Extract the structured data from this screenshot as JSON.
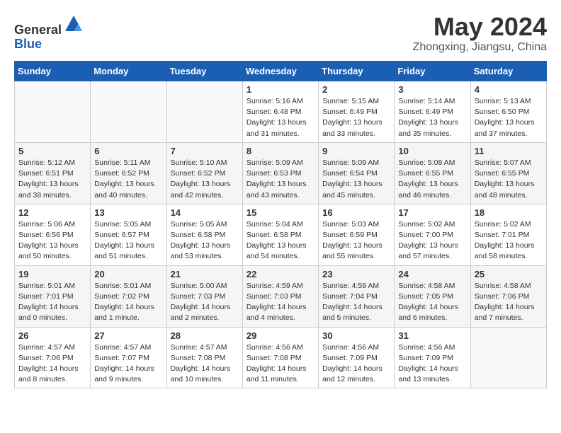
{
  "header": {
    "logo_line1": "General",
    "logo_line2": "Blue",
    "month_year": "May 2024",
    "location": "Zhongxing, Jiangsu, China"
  },
  "weekdays": [
    "Sunday",
    "Monday",
    "Tuesday",
    "Wednesday",
    "Thursday",
    "Friday",
    "Saturday"
  ],
  "weeks": [
    [
      {
        "day": "",
        "info": ""
      },
      {
        "day": "",
        "info": ""
      },
      {
        "day": "",
        "info": ""
      },
      {
        "day": "1",
        "info": "Sunrise: 5:16 AM\nSunset: 6:48 PM\nDaylight: 13 hours\nand 31 minutes."
      },
      {
        "day": "2",
        "info": "Sunrise: 5:15 AM\nSunset: 6:49 PM\nDaylight: 13 hours\nand 33 minutes."
      },
      {
        "day": "3",
        "info": "Sunrise: 5:14 AM\nSunset: 6:49 PM\nDaylight: 13 hours\nand 35 minutes."
      },
      {
        "day": "4",
        "info": "Sunrise: 5:13 AM\nSunset: 6:50 PM\nDaylight: 13 hours\nand 37 minutes."
      }
    ],
    [
      {
        "day": "5",
        "info": "Sunrise: 5:12 AM\nSunset: 6:51 PM\nDaylight: 13 hours\nand 38 minutes."
      },
      {
        "day": "6",
        "info": "Sunrise: 5:11 AM\nSunset: 6:52 PM\nDaylight: 13 hours\nand 40 minutes."
      },
      {
        "day": "7",
        "info": "Sunrise: 5:10 AM\nSunset: 6:52 PM\nDaylight: 13 hours\nand 42 minutes."
      },
      {
        "day": "8",
        "info": "Sunrise: 5:09 AM\nSunset: 6:53 PM\nDaylight: 13 hours\nand 43 minutes."
      },
      {
        "day": "9",
        "info": "Sunrise: 5:09 AM\nSunset: 6:54 PM\nDaylight: 13 hours\nand 45 minutes."
      },
      {
        "day": "10",
        "info": "Sunrise: 5:08 AM\nSunset: 6:55 PM\nDaylight: 13 hours\nand 46 minutes."
      },
      {
        "day": "11",
        "info": "Sunrise: 5:07 AM\nSunset: 6:55 PM\nDaylight: 13 hours\nand 48 minutes."
      }
    ],
    [
      {
        "day": "12",
        "info": "Sunrise: 5:06 AM\nSunset: 6:56 PM\nDaylight: 13 hours\nand 50 minutes."
      },
      {
        "day": "13",
        "info": "Sunrise: 5:05 AM\nSunset: 6:57 PM\nDaylight: 13 hours\nand 51 minutes."
      },
      {
        "day": "14",
        "info": "Sunrise: 5:05 AM\nSunset: 6:58 PM\nDaylight: 13 hours\nand 53 minutes."
      },
      {
        "day": "15",
        "info": "Sunrise: 5:04 AM\nSunset: 6:58 PM\nDaylight: 13 hours\nand 54 minutes."
      },
      {
        "day": "16",
        "info": "Sunrise: 5:03 AM\nSunset: 6:59 PM\nDaylight: 13 hours\nand 55 minutes."
      },
      {
        "day": "17",
        "info": "Sunrise: 5:02 AM\nSunset: 7:00 PM\nDaylight: 13 hours\nand 57 minutes."
      },
      {
        "day": "18",
        "info": "Sunrise: 5:02 AM\nSunset: 7:01 PM\nDaylight: 13 hours\nand 58 minutes."
      }
    ],
    [
      {
        "day": "19",
        "info": "Sunrise: 5:01 AM\nSunset: 7:01 PM\nDaylight: 14 hours\nand 0 minutes."
      },
      {
        "day": "20",
        "info": "Sunrise: 5:01 AM\nSunset: 7:02 PM\nDaylight: 14 hours\nand 1 minute."
      },
      {
        "day": "21",
        "info": "Sunrise: 5:00 AM\nSunset: 7:03 PM\nDaylight: 14 hours\nand 2 minutes."
      },
      {
        "day": "22",
        "info": "Sunrise: 4:59 AM\nSunset: 7:03 PM\nDaylight: 14 hours\nand 4 minutes."
      },
      {
        "day": "23",
        "info": "Sunrise: 4:59 AM\nSunset: 7:04 PM\nDaylight: 14 hours\nand 5 minutes."
      },
      {
        "day": "24",
        "info": "Sunrise: 4:58 AM\nSunset: 7:05 PM\nDaylight: 14 hours\nand 6 minutes."
      },
      {
        "day": "25",
        "info": "Sunrise: 4:58 AM\nSunset: 7:06 PM\nDaylight: 14 hours\nand 7 minutes."
      }
    ],
    [
      {
        "day": "26",
        "info": "Sunrise: 4:57 AM\nSunset: 7:06 PM\nDaylight: 14 hours\nand 8 minutes."
      },
      {
        "day": "27",
        "info": "Sunrise: 4:57 AM\nSunset: 7:07 PM\nDaylight: 14 hours\nand 9 minutes."
      },
      {
        "day": "28",
        "info": "Sunrise: 4:57 AM\nSunset: 7:08 PM\nDaylight: 14 hours\nand 10 minutes."
      },
      {
        "day": "29",
        "info": "Sunrise: 4:56 AM\nSunset: 7:08 PM\nDaylight: 14 hours\nand 11 minutes."
      },
      {
        "day": "30",
        "info": "Sunrise: 4:56 AM\nSunset: 7:09 PM\nDaylight: 14 hours\nand 12 minutes."
      },
      {
        "day": "31",
        "info": "Sunrise: 4:56 AM\nSunset: 7:09 PM\nDaylight: 14 hours\nand 13 minutes."
      },
      {
        "day": "",
        "info": ""
      }
    ]
  ]
}
